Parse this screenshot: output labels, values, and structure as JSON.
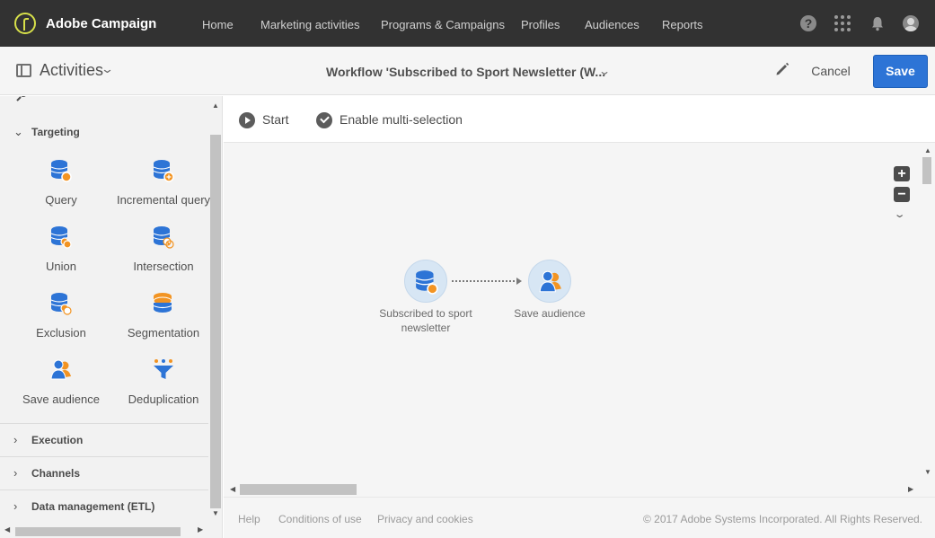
{
  "app": {
    "brand": "Adobe Campaign",
    "nav": [
      "Home",
      "Marketing activities",
      "Programs & Campaigns",
      "Profiles",
      "Audiences",
      "Reports"
    ],
    "icons": [
      "help-icon",
      "apps-icon",
      "bell-icon",
      "avatar-icon"
    ]
  },
  "header": {
    "panel_title": "Activities",
    "workflow_title": "Workflow 'Subscribed to Sport Newsletter (W...",
    "cancel_label": "Cancel",
    "save_label": "Save",
    "accent_color": "#2d74d6"
  },
  "sidebar": {
    "sections": [
      {
        "label": "Targeting",
        "expanded": true,
        "tiles": [
          {
            "label": "Query",
            "icon": "query-icon"
          },
          {
            "label": "Incremental query",
            "icon": "incremental-query-icon"
          },
          {
            "label": "Union",
            "icon": "union-icon"
          },
          {
            "label": "Intersection",
            "icon": "intersection-icon"
          },
          {
            "label": "Exclusion",
            "icon": "exclusion-icon"
          },
          {
            "label": "Segmentation",
            "icon": "segmentation-icon"
          },
          {
            "label": "Save audience",
            "icon": "save-audience-icon"
          },
          {
            "label": "Deduplication",
            "icon": "deduplication-icon"
          }
        ]
      },
      {
        "label": "Execution",
        "expanded": false
      },
      {
        "label": "Channels",
        "expanded": false
      },
      {
        "label": "Data management (ETL)",
        "expanded": false
      }
    ]
  },
  "toolbar": {
    "start_label": "Start",
    "multi_label": "Enable multi-selection"
  },
  "workflow": {
    "nodes": [
      {
        "label": "Subscribed to sport newsletter",
        "icon": "query-icon"
      },
      {
        "label": "Save audience",
        "icon": "save-audience-icon"
      }
    ]
  },
  "footer": {
    "links": [
      "Help",
      "Conditions of use",
      "Privacy and cookies"
    ],
    "copyright": "© 2017 Adobe Systems Incorporated. All Rights Reserved."
  }
}
